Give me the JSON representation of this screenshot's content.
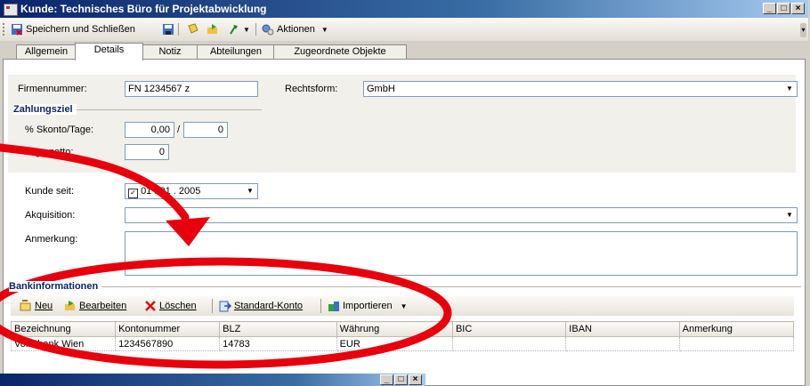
{
  "window": {
    "title": "Kunde: Technisches Büro für Projektabwicklung"
  },
  "toolbar": {
    "save_close": "Speichern und Schließen",
    "actions": "Aktionen"
  },
  "tabs": [
    "Allgemein",
    "Details",
    "Notiz",
    "Abteilungen",
    "Zugeordnete Objekte"
  ],
  "form": {
    "firmennummer_label": "Firmennummer:",
    "firmennummer_value": "FN 1234567 z",
    "rechtsform_label": "Rechtsform:",
    "rechtsform_value": "GmbH",
    "zahlungsziel_title": "Zahlungsziel",
    "skonto_label": "% Skonto/Tage:",
    "skonto_value": "0,00",
    "skonto_sep": "/",
    "skonto_days": "0",
    "tage_netto_label": "Tage netto:",
    "tage_netto_value": "0",
    "kunde_seit_label": "Kunde seit:",
    "kunde_seit_value": "01 . 01 . 2005",
    "akquisition_label": "Akquisition:",
    "akquisition_value": "",
    "anmerkung_label": "Anmerkung:",
    "anmerkung_value": ""
  },
  "bank": {
    "title": "Bankinformationen",
    "buttons": {
      "new": "Neu",
      "edit": "Bearbeiten",
      "delete": "Löschen",
      "standard": "Standard-Konto",
      "import": "Importieren"
    },
    "columns": [
      "Bezeichnung",
      "Kontonummer",
      "BLZ",
      "Währung",
      "BIC",
      "IBAN",
      "Anmerkung"
    ],
    "rows": [
      [
        "Volksbank Wien",
        "1234567890",
        "14783",
        "EUR",
        "",
        "",
        ""
      ]
    ]
  },
  "colors": {
    "annotation": "#e8000c",
    "title_bar": "#0a246a"
  }
}
